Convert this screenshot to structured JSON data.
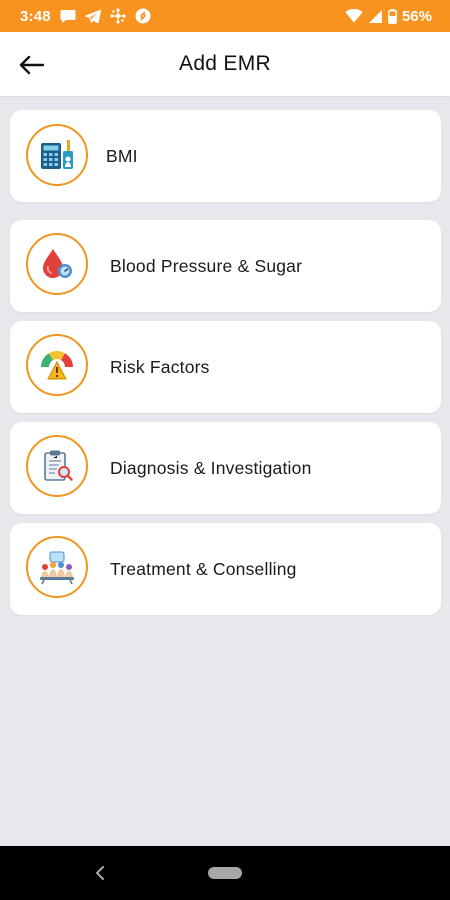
{
  "status_bar": {
    "time": "3:48",
    "battery": "56%",
    "icons": [
      "chat-icon",
      "telegram-icon",
      "network-icon",
      "shazam-icon",
      "wifi-icon",
      "signal-icon",
      "battery-icon"
    ]
  },
  "app_bar": {
    "title": "Add EMR",
    "back_icon": "arrow-left-icon"
  },
  "menu": {
    "items": [
      {
        "label": "BMI",
        "icon": "bmi-calculator-icon"
      },
      {
        "label": "Blood Pressure & Sugar",
        "icon": "blood-drop-icon"
      },
      {
        "label": "Risk Factors",
        "icon": "risk-gauge-icon"
      },
      {
        "label": "Diagnosis & Investigation",
        "icon": "clipboard-search-icon"
      },
      {
        "label": "Treatment & Conselling",
        "icon": "counselling-group-icon"
      }
    ]
  },
  "colors": {
    "status_bar": "#f7931e",
    "icon_ring": "#f0951f",
    "background": "#e8e8ec"
  }
}
